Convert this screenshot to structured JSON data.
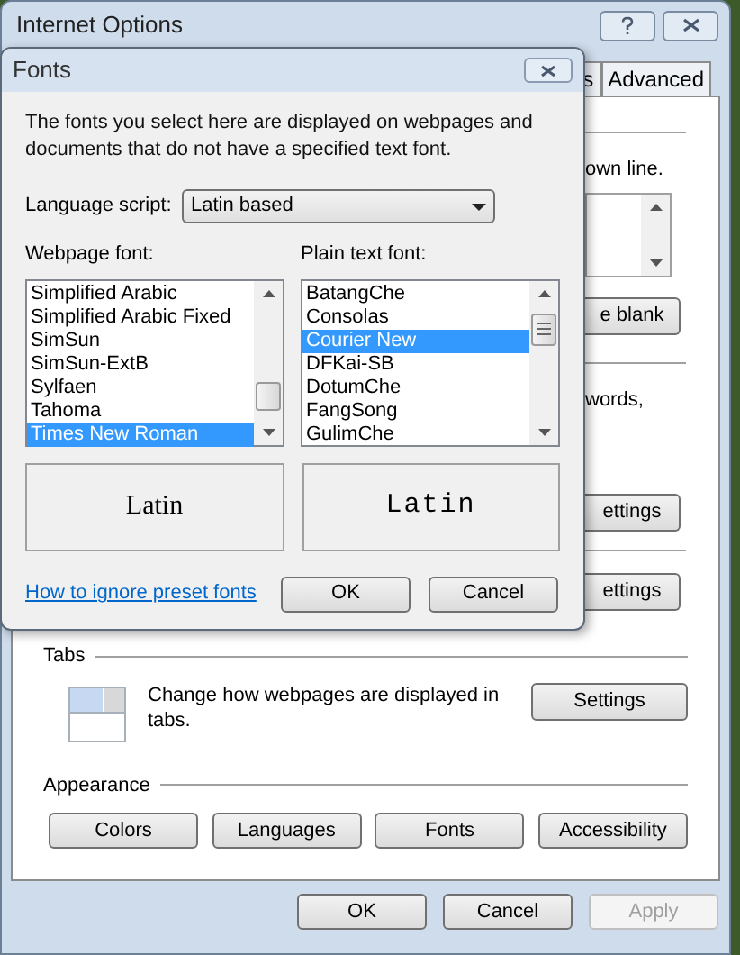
{
  "main_window": {
    "title": "Internet Options",
    "tabs": [
      {
        "label": "s",
        "selected": false
      },
      {
        "label": "Advanced",
        "selected": false
      }
    ],
    "fragments": {
      "text_1": "own line.",
      "button_1": "e blank",
      "text_2": "words,",
      "button_2": "ettings",
      "button_3": "ettings"
    },
    "tabs_section": {
      "heading": "Tabs",
      "description": "Change how webpages are displayed in tabs.",
      "button": "Settings"
    },
    "appearance": {
      "heading": "Appearance",
      "buttons": [
        "Colors",
        "Languages",
        "Fonts",
        "Accessibility"
      ]
    },
    "footer_buttons": [
      {
        "label": "OK",
        "disabled": false
      },
      {
        "label": "Cancel",
        "disabled": false
      },
      {
        "label": "Apply",
        "disabled": true
      }
    ]
  },
  "fonts_dialog": {
    "title": "Fonts",
    "description": "The fonts you select here are displayed on webpages and documents that do not have a specified text font.",
    "language_script": {
      "label": "Language script:",
      "value": "Latin based"
    },
    "lists": [
      {
        "label": "Webpage font:",
        "preview": "Latin",
        "items": [
          {
            "name": "Simplified Arabic",
            "selected": false
          },
          {
            "name": "Simplified Arabic Fixed",
            "selected": false
          },
          {
            "name": "SimSun",
            "selected": false
          },
          {
            "name": "SimSun-ExtB",
            "selected": false
          },
          {
            "name": "Sylfaen",
            "selected": false
          },
          {
            "name": "Tahoma",
            "selected": false
          },
          {
            "name": "Times New Roman",
            "selected": true
          }
        ]
      },
      {
        "label": "Plain text font:",
        "preview": "Latin",
        "items": [
          {
            "name": "BatangChe",
            "selected": false
          },
          {
            "name": "Consolas",
            "selected": false
          },
          {
            "name": "Courier New",
            "selected": true
          },
          {
            "name": "DFKai-SB",
            "selected": false
          },
          {
            "name": "DotumChe",
            "selected": false
          },
          {
            "name": "FangSong",
            "selected": false
          },
          {
            "name": "GulimChe",
            "selected": false
          }
        ]
      }
    ],
    "link": "How to ignore preset fonts",
    "buttons": [
      "OK",
      "Cancel"
    ]
  }
}
